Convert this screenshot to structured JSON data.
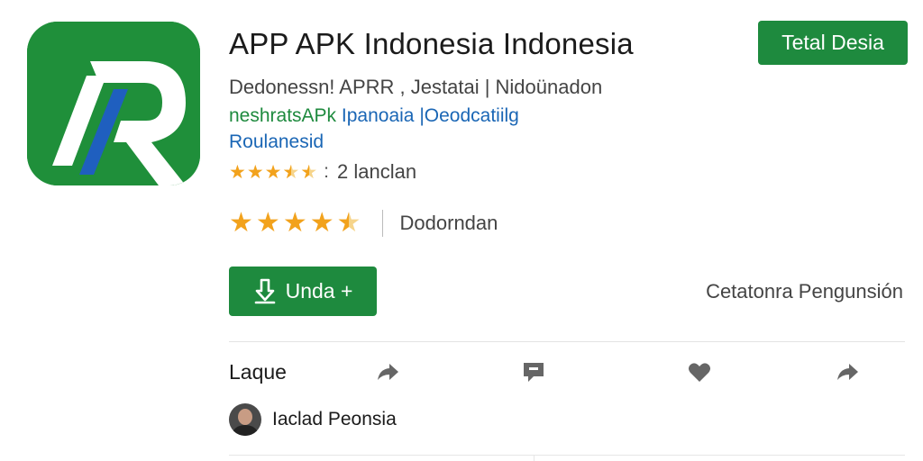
{
  "app": {
    "title": "APP APK Indonesia Indonesia",
    "meta": "Dedonessn! APRR , Jestatai | Nidoünadon",
    "developer_green": "neshratsAPk",
    "developer_blue": "Ipanoaia |Oeodcatiilg",
    "developer_line2": "Roulanesid",
    "rating_count_text": "2 lanclan",
    "rating_label": "Dodorndan"
  },
  "buttons": {
    "install_top": "Tetal Desia",
    "download": "Unda +"
  },
  "links": {
    "right": "Cetatonra Pengunsión"
  },
  "actions": {
    "label": "Laque",
    "icons": [
      "share-icon",
      "comment-icon",
      "heart-icon",
      "forward-icon"
    ]
  },
  "user": {
    "name": "Iaclad Peonsia"
  },
  "colors": {
    "accent_green": "#1e8a3e",
    "link_blue": "#1a66b5",
    "star": "#f2a21c"
  },
  "ratings": {
    "small_stars": 3.5,
    "big_stars": 4.5
  }
}
